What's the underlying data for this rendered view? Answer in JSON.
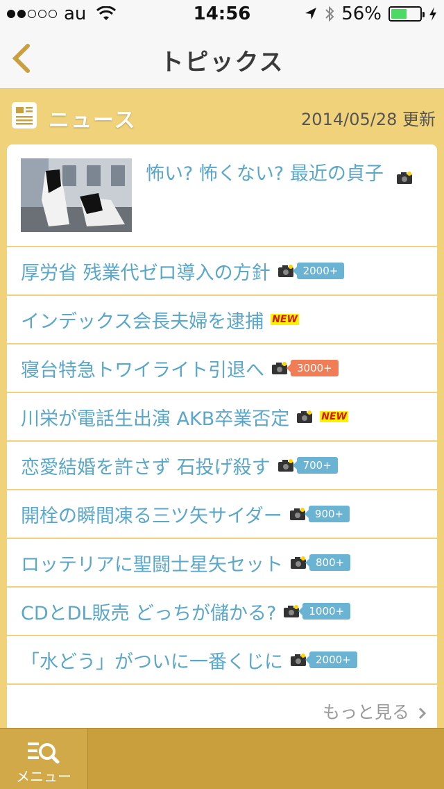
{
  "status_bar": {
    "carrier": "au",
    "time": "14:56",
    "battery": "56%",
    "battery_level": 0.56,
    "signal_bars": 2
  },
  "nav": {
    "title": "トピックス"
  },
  "section": {
    "title": "ニュース",
    "updated": "2014/05/28 更新"
  },
  "featured": {
    "title": "怖い? 怖くない? 最近の貞子"
  },
  "items": [
    {
      "title": "厚労省 残業代ゼロ導入の方針",
      "badge": "2000+"
    },
    {
      "title": "インデックス会長夫婦を逮捕",
      "new": "NEW"
    },
    {
      "title": "寝台特急トワイライト引退へ",
      "badge": "3000+"
    },
    {
      "title": "川栄が電話生出演 AKB卒業否定",
      "new": "NEW"
    },
    {
      "title": "恋愛結婚を許さず 石投げ殺す",
      "badge": "700+"
    },
    {
      "title": "開栓の瞬間凍る三ツ矢サイダー",
      "badge": "900+"
    },
    {
      "title": "ロッテリアに聖闘士星矢セット",
      "badge": "800+"
    },
    {
      "title": "CDとDL販売 どっちが儲かる?",
      "badge": "1000+"
    },
    {
      "title": "「水どう」がついに一番くじに",
      "badge": "2000+"
    }
  ],
  "more_label": "もっと見る",
  "tab_bar": {
    "menu_label": "メニュー"
  },
  "colors": {
    "accent_gold": "#f0d27a",
    "link_blue": "#5aa7c8",
    "badge_blue": "#6ab3d3",
    "badge_hot": "#f17d56",
    "tab_bg": "#c99e3d"
  }
}
